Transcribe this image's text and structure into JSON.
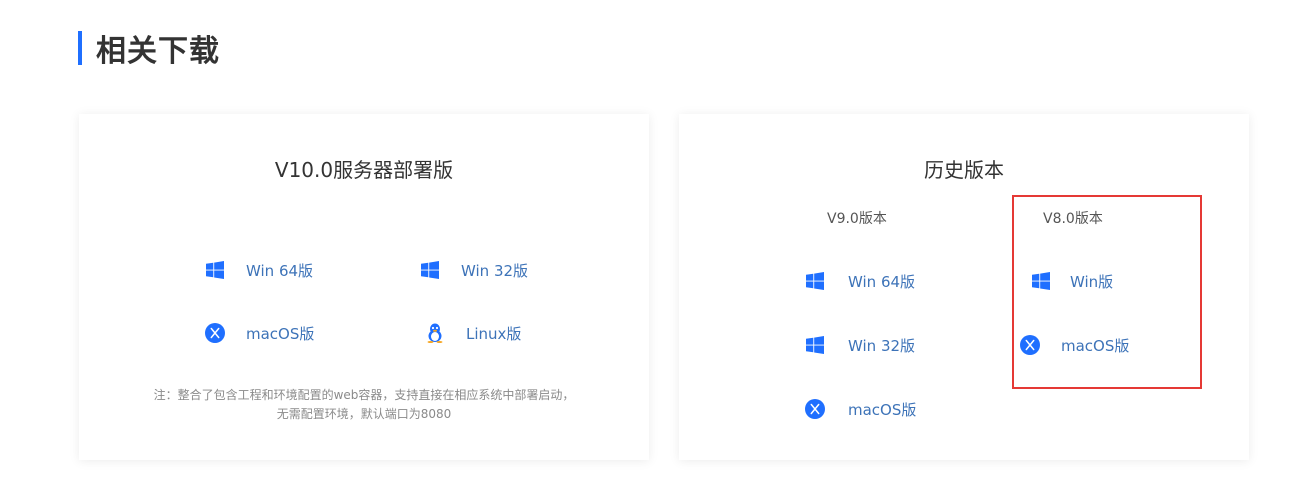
{
  "section": {
    "title": "相关下载"
  },
  "server_card": {
    "title": "V10.0服务器部署版",
    "downloads": [
      {
        "label": "Win 64版",
        "icon": "windows-icon"
      },
      {
        "label": "Win 32版",
        "icon": "windows-icon"
      },
      {
        "label": "macOS版",
        "icon": "macos-icon"
      },
      {
        "label": "Linux版",
        "icon": "linux-icon"
      }
    ],
    "note": "注：整合了包含工程和环境配置的web容器，支持直接在相应系统中部署启动，无需配置环境，默认端口为8080"
  },
  "history_card": {
    "title": "历史版本",
    "v9": {
      "title": "V9.0版本",
      "downloads": [
        {
          "label": "Win 64版",
          "icon": "windows-icon"
        },
        {
          "label": "Win 32版",
          "icon": "windows-icon"
        },
        {
          "label": "macOS版",
          "icon": "macos-icon"
        }
      ]
    },
    "v8": {
      "title": "V8.0版本",
      "downloads": [
        {
          "label": "Win版",
          "icon": "windows-icon"
        },
        {
          "label": "macOS版",
          "icon": "macos-icon"
        }
      ]
    }
  },
  "colors": {
    "accent": "#1f6fff",
    "link": "#3d73b8",
    "highlight": "#e53935"
  }
}
